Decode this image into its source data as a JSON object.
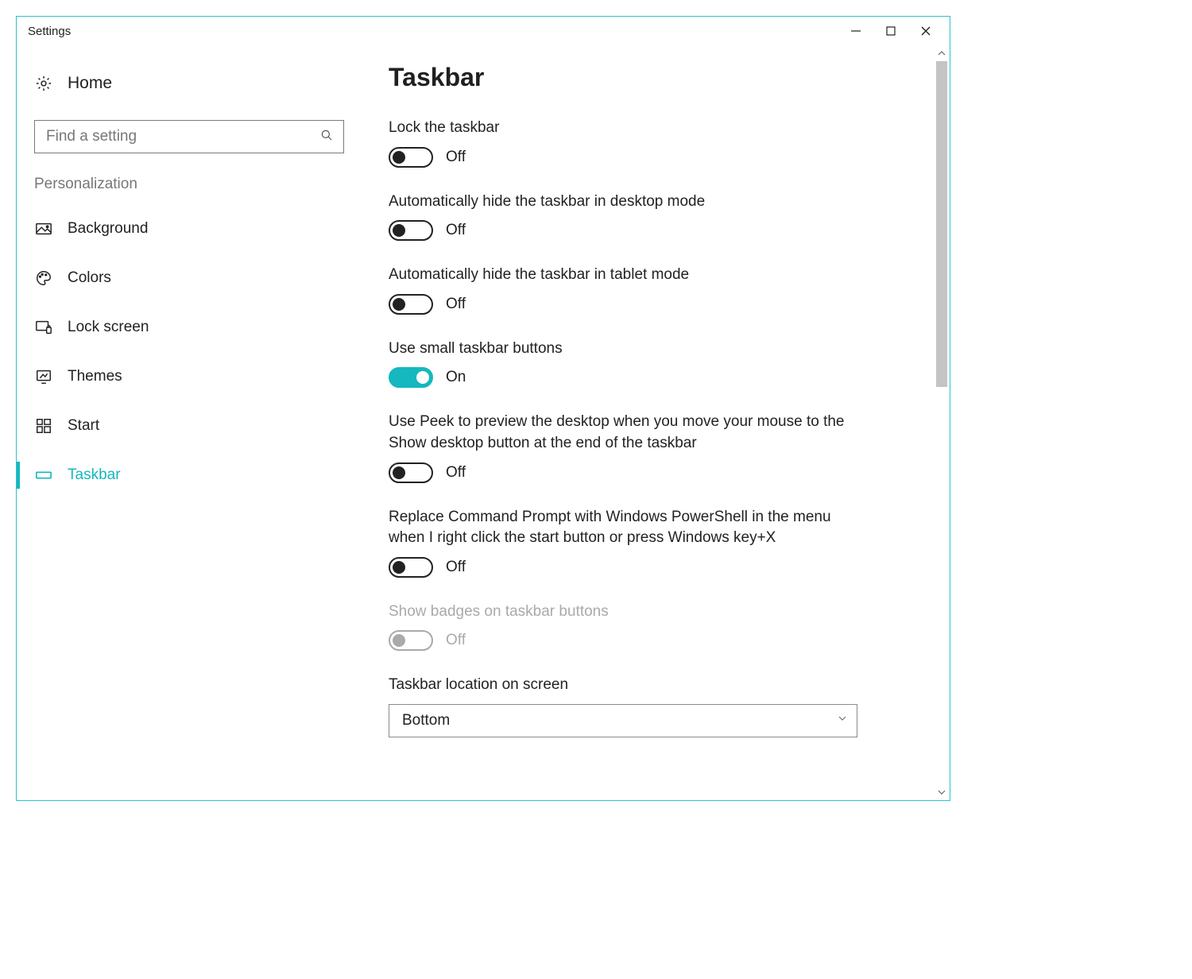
{
  "window": {
    "title": "Settings"
  },
  "sidebar": {
    "home": "Home",
    "search_placeholder": "Find a setting",
    "category": "Personalization",
    "items": [
      {
        "label": "Background"
      },
      {
        "label": "Colors"
      },
      {
        "label": "Lock screen"
      },
      {
        "label": "Themes"
      },
      {
        "label": "Start"
      },
      {
        "label": "Taskbar"
      }
    ]
  },
  "page": {
    "title": "Taskbar",
    "toggles": {
      "lock": {
        "label": "Lock the taskbar",
        "state": "Off"
      },
      "hide_desktop": {
        "label": "Automatically hide the taskbar in desktop mode",
        "state": "Off"
      },
      "hide_tablet": {
        "label": "Automatically hide the taskbar in tablet mode",
        "state": "Off"
      },
      "small_buttons": {
        "label": "Use small taskbar buttons",
        "state": "On"
      },
      "peek": {
        "label": "Use Peek to preview the desktop when you move your mouse to the Show desktop button at the end of the taskbar",
        "state": "Off"
      },
      "powershell": {
        "label": "Replace Command Prompt with Windows PowerShell in the menu when I right click the start button or press Windows key+X",
        "state": "Off"
      },
      "badges": {
        "label": "Show badges on taskbar buttons",
        "state": "Off"
      }
    },
    "location": {
      "label": "Taskbar location on screen",
      "value": "Bottom"
    }
  }
}
